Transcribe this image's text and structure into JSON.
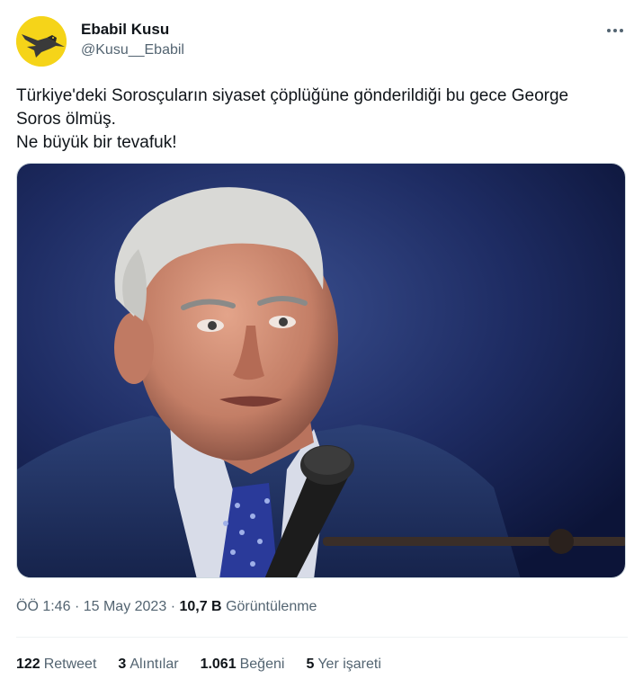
{
  "author": {
    "display_name": "Ebabil Kusu",
    "handle": "@Kusu__Ebabil",
    "avatar_icon": "swallow-bird-icon",
    "avatar_color": "#f5d419"
  },
  "tweet": {
    "lines": [
      "Türkiye'deki Sorosçuların siyaset çöplüğüne gönderildiği bu gece George",
      "Soros ölmüş.",
      "Ne büyük bir tevafuk!"
    ]
  },
  "media": {
    "description_icon": "photo-elderly-man-microphone"
  },
  "meta": {
    "time": "ÖÖ 1:46",
    "separator": "·",
    "date": "15 May 2023",
    "views_count": "10,7 B",
    "views_label": "Görüntülenme"
  },
  "stats": [
    {
      "count": "122",
      "label": "Retweet"
    },
    {
      "count": "3",
      "label": "Alıntılar"
    },
    {
      "count": "1.061",
      "label": "Beğeni"
    },
    {
      "count": "5",
      "label": "Yer işareti"
    }
  ],
  "more_icon": "more-dots-icon"
}
